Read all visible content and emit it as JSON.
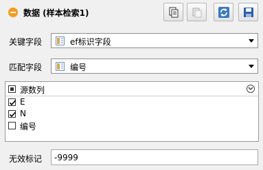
{
  "header": {
    "title": "数据 (样本检索1)",
    "toolbar": {
      "copy": "copy-icon",
      "paste": "paste-icon",
      "refresh": "refresh-icon",
      "save": "save-icon"
    },
    "accent_color": "#f29c1f"
  },
  "form": {
    "key_field": {
      "label": "关键字段",
      "value": "ef标识字段"
    },
    "match_field": {
      "label": "匹配字段",
      "value": "编号"
    }
  },
  "source_columns": {
    "header_label": "源数列",
    "items": [
      {
        "label": "E",
        "checked": true
      },
      {
        "label": "N",
        "checked": true
      },
      {
        "label": "编号",
        "checked": false
      }
    ]
  },
  "nodata": {
    "label": "无效标记",
    "value": "-9999"
  }
}
